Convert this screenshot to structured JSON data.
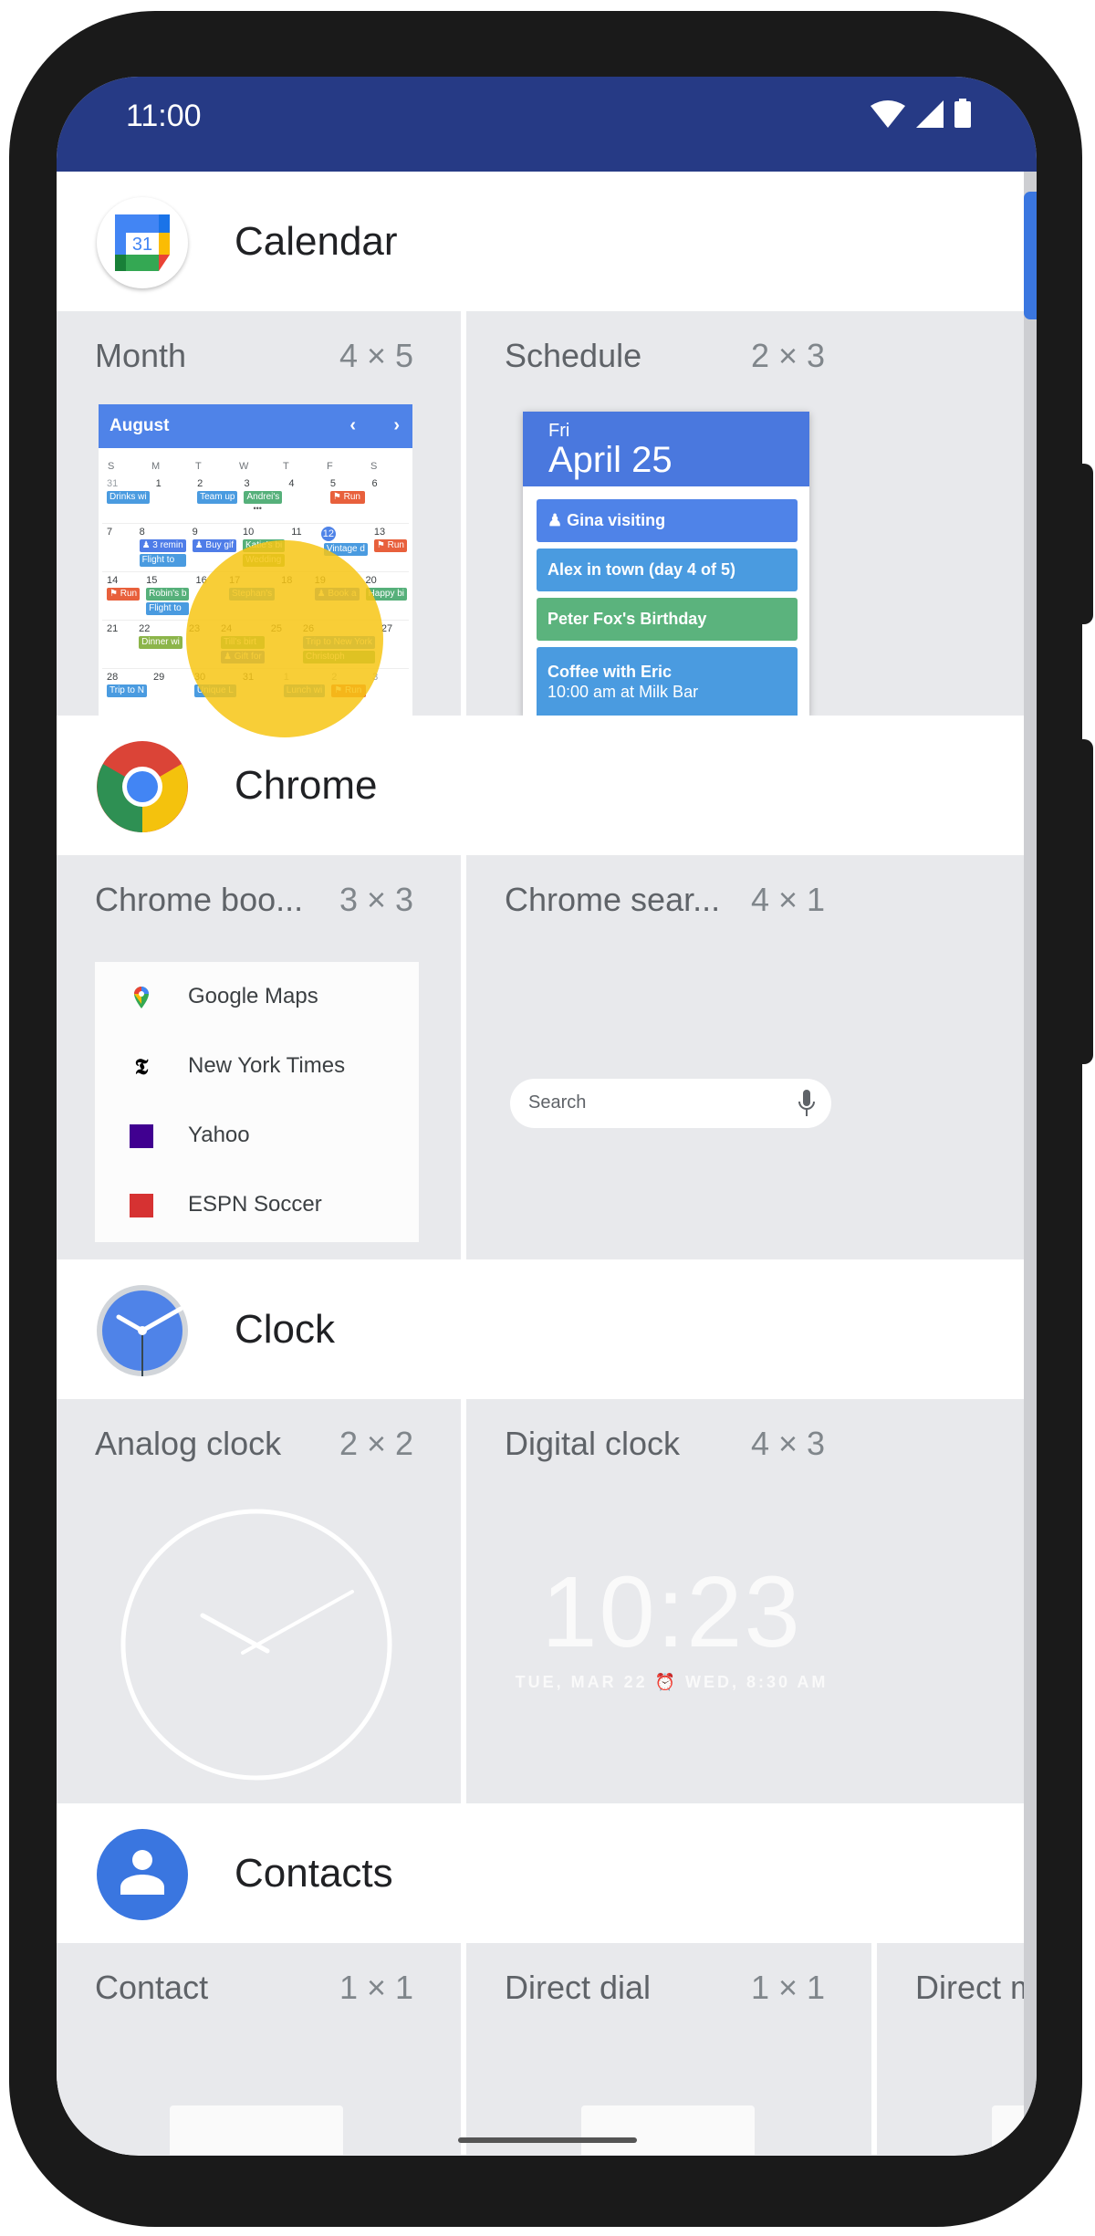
{
  "status_bar": {
    "time": "11:00",
    "icons": [
      "wifi-icon",
      "signal-icon",
      "battery-icon"
    ]
  },
  "apps": [
    {
      "name": "Calendar",
      "icon": "calendar-icon",
      "widgets": [
        {
          "title": "Month",
          "size": "4 × 5"
        },
        {
          "title": "Schedule",
          "size": "2 × 3"
        }
      ]
    },
    {
      "name": "Chrome",
      "icon": "chrome-icon",
      "widgets": [
        {
          "title": "Chrome boo...",
          "size": "3 × 3"
        },
        {
          "title": "Chrome sear...",
          "size": "4 × 1"
        }
      ]
    },
    {
      "name": "Clock",
      "icon": "clock-icon",
      "widgets": [
        {
          "title": "Analog clock",
          "size": "2 × 2"
        },
        {
          "title": "Digital clock",
          "size": "4 × 3"
        }
      ]
    },
    {
      "name": "Contacts",
      "icon": "contacts-icon",
      "widgets": [
        {
          "title": "Contact",
          "size": "1 × 1"
        },
        {
          "title": "Direct dial",
          "size": "1 × 1"
        },
        {
          "title": "Direct m",
          "size": ""
        }
      ]
    }
  ],
  "month_widget": {
    "month": "August",
    "prev": "‹",
    "next": "›",
    "weekdays": [
      "S",
      "M",
      "T",
      "W",
      "T",
      "F",
      "S"
    ],
    "weeks": [
      [
        {
          "d": "31",
          "muted": true,
          "ev": [
            [
              "Drinks wi",
              "#4a9be0"
            ]
          ]
        },
        {
          "d": "1",
          "ev": []
        },
        {
          "d": "2",
          "ev": [
            [
              "Team up",
              "#4a9be0"
            ]
          ]
        },
        {
          "d": "3",
          "ev": [
            [
              "Andrei's",
              "#56b07a"
            ]
          ],
          "more": "•••"
        },
        {
          "d": "4",
          "ev": []
        },
        {
          "d": "5",
          "ev": [
            [
              "⚑ Run",
              "#e8603c"
            ]
          ]
        },
        {
          "d": "6",
          "ev": []
        }
      ],
      [
        {
          "d": "7",
          "ev": []
        },
        {
          "d": "8",
          "ev": [
            [
              "♟ 3 remin",
              "#4f7de8"
            ],
            [
              "Flight to",
              "#4a9be0"
            ]
          ]
        },
        {
          "d": "9",
          "ev": [
            [
              "♟ Buy gif",
              "#4f7de8"
            ]
          ]
        },
        {
          "d": "10",
          "ev": [
            [
              "Katie's bi",
              "#56b07a"
            ],
            [
              "Wedding",
              "#8cb54a"
            ]
          ]
        },
        {
          "d": "11",
          "ev": []
        },
        {
          "d": "12",
          "today": true,
          "ev": [
            [
              "Vintage d",
              "#4a9be0"
            ]
          ]
        },
        {
          "d": "13",
          "ev": [
            [
              "⚑ Run",
              "#e8603c"
            ]
          ]
        }
      ],
      [
        {
          "d": "14",
          "ev": [
            [
              "⚑ Run",
              "#e8603c"
            ]
          ]
        },
        {
          "d": "15",
          "ev": [
            [
              "Robin's b",
              "#56b07a"
            ],
            [
              "Flight to",
              "#4a9be0"
            ]
          ]
        },
        {
          "d": "16",
          "ev": []
        },
        {
          "d": "17",
          "ev": [
            [
              "Stephan's",
              "#4a9be0"
            ]
          ]
        },
        {
          "d": "18",
          "ev": []
        },
        {
          "d": "19",
          "ev": [
            [
              "♟ Book a",
              "#4f7de8"
            ]
          ]
        },
        {
          "d": "20",
          "ev": [
            [
              "Happy bi",
              "#56b07a"
            ]
          ]
        }
      ],
      [
        {
          "d": "21",
          "ev": []
        },
        {
          "d": "22",
          "ev": [
            [
              "Dinner wi",
              "#8cb54a"
            ]
          ]
        },
        {
          "d": "23",
          "ev": []
        },
        {
          "d": "24",
          "ev": [
            [
              "Till's birt",
              "#56b07a"
            ],
            [
              "♟ Gift for",
              "#4f7de8"
            ]
          ]
        },
        {
          "d": "25",
          "ev": []
        },
        {
          "d": "26",
          "ev": [
            [
              "Trip to New York",
              "#4a9be0"
            ],
            [
              "Christoph",
              "#56b07a"
            ]
          ]
        },
        {
          "d": "27",
          "ev": []
        }
      ],
      [
        {
          "d": "28",
          "ev": [
            [
              "Trip to N",
              "#4a9be0"
            ]
          ]
        },
        {
          "d": "29",
          "ev": []
        },
        {
          "d": "30",
          "ev": [
            [
              "Unique L",
              "#4a9be0"
            ]
          ]
        },
        {
          "d": "31",
          "ev": []
        },
        {
          "d": "1",
          "muted": true,
          "ev": [
            [
              "Lunch wi",
              "#4a9be0"
            ]
          ]
        },
        {
          "d": "2",
          "muted": true,
          "ev": [
            [
              "⚑ Run",
              "#e8603c"
            ]
          ]
        },
        {
          "d": "3",
          "muted": true,
          "ev": []
        }
      ]
    ]
  },
  "schedule_widget": {
    "weekday": "Fri",
    "date": "April 25",
    "events": [
      {
        "label": "♟ Gina visiting",
        "color": "#4f83e8"
      },
      {
        "label": "Alex in town (day 4 of 5)",
        "color": "#4a9be0"
      },
      {
        "label": "Peter Fox's Birthday",
        "color": "#5bb37d"
      },
      {
        "label": "Coffee with Eric",
        "sub": "10:00 am at Milk Bar",
        "color": "#4a9be0"
      }
    ]
  },
  "bookmarks_widget": {
    "items": [
      {
        "label": "Google Maps",
        "icon": "google-maps-icon"
      },
      {
        "label": "New York Times",
        "icon": "nyt-icon"
      },
      {
        "label": "Yahoo",
        "icon": "yahoo-icon"
      },
      {
        "label": "ESPN Soccer",
        "icon": "espn-icon"
      }
    ]
  },
  "search_widget": {
    "placeholder": "Search"
  },
  "digital_clock": {
    "time": "10:23",
    "date": "TUE, MAR 22",
    "alarm": "WED, 8:30 AM"
  },
  "colors": {
    "status_bar": "#263a85",
    "accent": "#3a76e0",
    "touch_indicator": "#f7c614"
  }
}
